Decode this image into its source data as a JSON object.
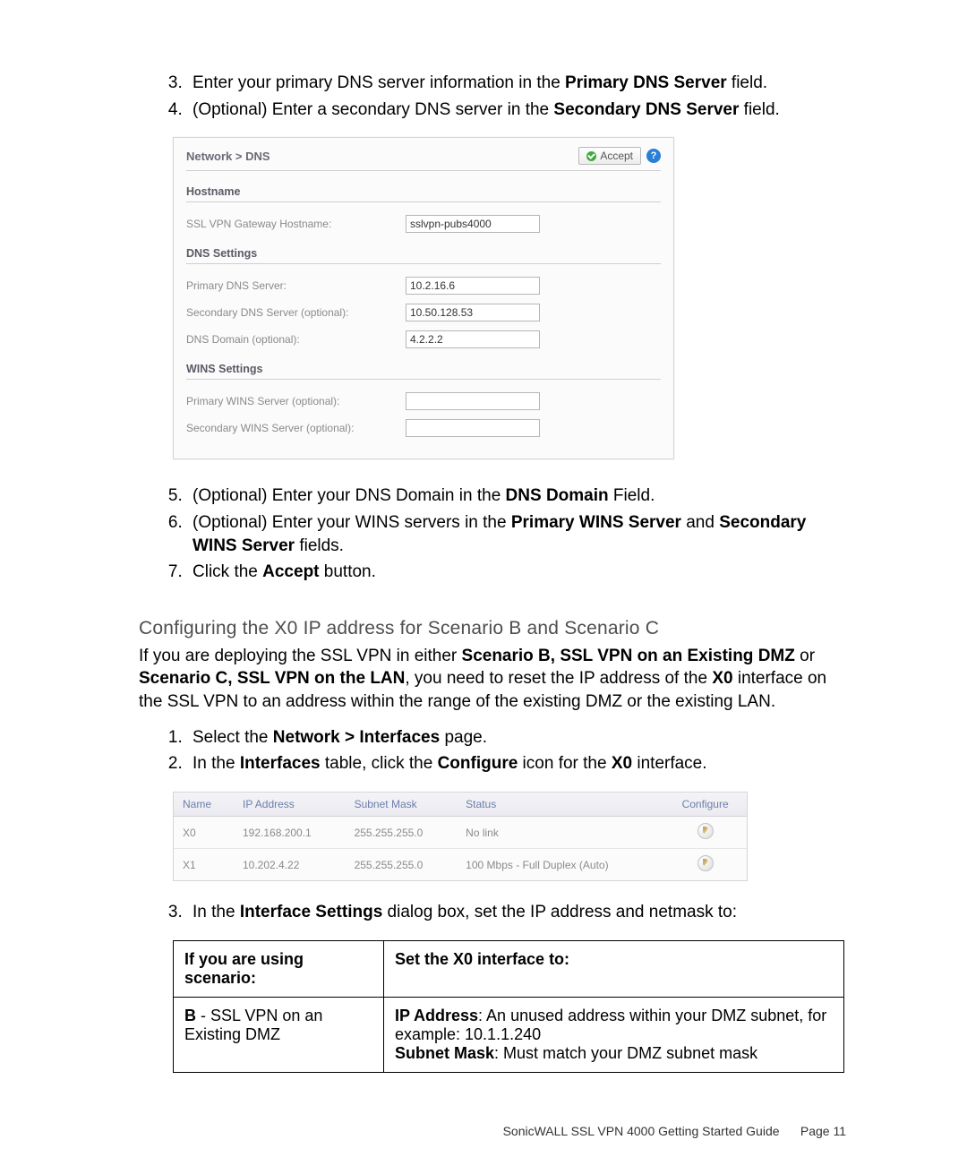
{
  "steps_a": [
    {
      "num": "3.",
      "pre": "Enter your primary DNS server information in the ",
      "bold": "Primary DNS Server",
      "post": " field."
    },
    {
      "num": "4.",
      "pre": "(Optional) Enter a secondary DNS server in the ",
      "bold": "Secondary DNS Server",
      "post": " field."
    }
  ],
  "dns_shot": {
    "breadcrumb": "Network > DNS",
    "accept_label": "Accept",
    "section_hostname": "Hostname",
    "hostname_label": "SSL VPN Gateway Hostname:",
    "hostname_value": "sslvpn-pubs4000",
    "section_dns": "DNS Settings",
    "primary_dns_label": "Primary DNS Server:",
    "primary_dns_value": "10.2.16.6",
    "secondary_dns_label": "Secondary DNS Server (optional):",
    "secondary_dns_value": "10.50.128.53",
    "dns_domain_label": "DNS Domain (optional):",
    "dns_domain_value": "4.2.2.2",
    "section_wins": "WINS Settings",
    "primary_wins_label": "Primary WINS Server (optional):",
    "primary_wins_value": "",
    "secondary_wins_label": "Secondary WINS Server (optional):",
    "secondary_wins_value": ""
  },
  "steps_b": [
    {
      "num": "5.",
      "segs": [
        {
          "t": "(Optional) Enter your DNS Domain in the "
        },
        {
          "t": "DNS Domain",
          "b": true
        },
        {
          "t": " Field."
        }
      ]
    },
    {
      "num": "6.",
      "segs": [
        {
          "t": "(Optional) Enter your WINS servers in the "
        },
        {
          "t": "Primary WINS Server",
          "b": true
        },
        {
          "t": " and "
        },
        {
          "t": "Secondary WINS Server",
          "b": true
        },
        {
          "t": " fields."
        }
      ]
    },
    {
      "num": "7.",
      "segs": [
        {
          "t": "Click the "
        },
        {
          "t": "Accept",
          "b": true
        },
        {
          "t": " button."
        }
      ]
    }
  ],
  "heading": "Configuring the X0 IP address for Scenario B and Scenario C",
  "heading_para": {
    "segs": [
      {
        "t": "If you are deploying the SSL VPN in either "
      },
      {
        "t": "Scenario B, SSL VPN on an Existing DMZ",
        "b": true
      },
      {
        "t": " or "
      },
      {
        "t": "Scenario C, SSL VPN on the LAN",
        "b": true
      },
      {
        "t": ", you need to reset the IP address of the "
      },
      {
        "t": "X0",
        "b": true
      },
      {
        "t": " interface on the SSL VPN to an address within the range of the existing DMZ or the existing LAN."
      }
    ]
  },
  "steps_c": [
    {
      "num": "1.",
      "segs": [
        {
          "t": "Select the "
        },
        {
          "t": "Network > Interfaces",
          "b": true
        },
        {
          "t": " page."
        }
      ]
    },
    {
      "num": "2.",
      "segs": [
        {
          "t": "In the "
        },
        {
          "t": "Interfaces",
          "b": true
        },
        {
          "t": " table, click the "
        },
        {
          "t": "Configure",
          "b": true
        },
        {
          "t": " icon for the "
        },
        {
          "t": "X0",
          "b": true
        },
        {
          "t": " interface."
        }
      ]
    }
  ],
  "iface_table": {
    "headers": [
      "Name",
      "IP Address",
      "Subnet Mask",
      "Status",
      "Configure"
    ],
    "rows": [
      {
        "name": "X0",
        "ip": "192.168.200.1",
        "mask": "255.255.255.0",
        "status": "No link"
      },
      {
        "name": "X1",
        "ip": "10.202.4.22",
        "mask": "255.255.255.0",
        "status": "100 Mbps - Full Duplex (Auto)"
      }
    ]
  },
  "steps_d": [
    {
      "num": "3.",
      "segs": [
        {
          "t": "In the "
        },
        {
          "t": "Interface Settings",
          "b": true
        },
        {
          "t": " dialog box, set the IP address and netmask to:"
        }
      ]
    }
  ],
  "scenario_table": {
    "header_left": "If you are using scenario:",
    "header_right": "Set the X0 interface to:",
    "row": {
      "left_segs": [
        {
          "t": "B",
          "b": true
        },
        {
          "t": " - SSL VPN on an Existing DMZ"
        }
      ],
      "right_segs": [
        {
          "t": "IP Address",
          "b": true
        },
        {
          "t": ": An unused address within your DMZ subnet, for example: 10.1.1.240"
        },
        {
          "br": true
        },
        {
          "t": "Subnet Mask",
          "b": true
        },
        {
          "t": ": Must match your DMZ subnet mask"
        }
      ]
    }
  },
  "footer": {
    "title": "SonicWALL SSL VPN 4000 Getting Started Guide",
    "page": "Page 11"
  }
}
